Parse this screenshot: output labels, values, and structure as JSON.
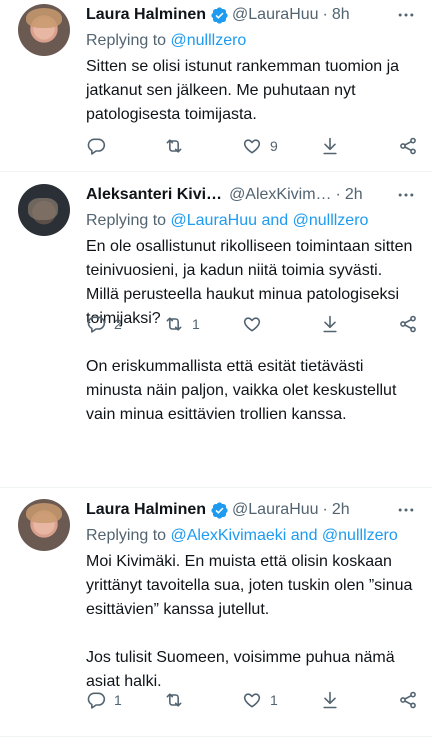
{
  "tweets": [
    {
      "name": "Laura Halminen",
      "handle": "@LauraHuu",
      "time": "8h",
      "replying_prefix": "Replying to ",
      "replying_to": "@nulllzero",
      "body": "Sitten se olisi istunut rankemman tuomion ja jatkanut sen jälkeen. Me puhutaan nyt patologisesta toimijasta.",
      "replies": "",
      "retweets": "",
      "likes": "9"
    },
    {
      "name": "Aleksanteri Kivi…",
      "handle": "@AlexKivim…",
      "time": "2h",
      "replying_prefix": "Replying to ",
      "replying_to": "@LauraHuu and @nulllzero",
      "body": "En ole osallistunut rikolliseen toimintaan sitten teinivuosieni, ja kadun niitä toimia syvästi. Millä perusteella haukut minua patologiseksi toimijaksi?\n\nOn eriskummallista että esität tietävästi minusta näin paljon, vaikka olet keskustellut vain minua esittävien trollien kanssa.",
      "replies": "2",
      "retweets": "1",
      "likes": ""
    },
    {
      "name": "Laura Halminen",
      "handle": "@LauraHuu",
      "time": "2h",
      "replying_prefix": "Replying to ",
      "replying_to": "@AlexKivimaeki and @nulllzero",
      "body": "Moi Kivimäki. En muista että olisin koskaan yrittänyt tavoitella sua, joten tuskin olen ”sinua esittävien” kanssa jutellut.\n\nJos tulisit Suomeen, voisimme puhua nämä asiat halki.",
      "replies": "1",
      "retweets": "",
      "likes": "1"
    }
  ],
  "separator": "·",
  "icons": [
    "verified-badge-icon",
    "more-icon",
    "reply-icon",
    "retweet-icon",
    "like-icon",
    "download-icon",
    "share-icon"
  ],
  "colors": {
    "accent": "#1d9bf0",
    "secondary_text": "#536471",
    "text": "#0f1419"
  }
}
